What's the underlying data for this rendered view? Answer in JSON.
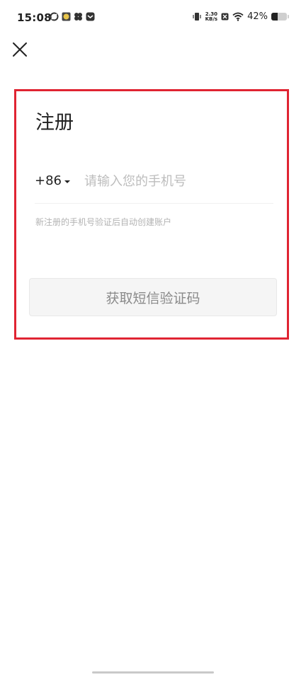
{
  "status_bar": {
    "time": "15:08",
    "speed_value": "2.30",
    "speed_unit": "KB/s",
    "battery_percent_text": "42%",
    "battery_level": 0.42
  },
  "register": {
    "title": "注册",
    "country_code": "+86",
    "phone_placeholder": "请输入您的手机号",
    "phone_value": "",
    "hint": "新注册的手机号验证后自动创建账户",
    "sms_button_label": "获取短信验证码"
  },
  "colors": {
    "highlight_border": "#e02432",
    "button_bg": "#f5f5f5",
    "placeholder": "#bdbdbd"
  }
}
